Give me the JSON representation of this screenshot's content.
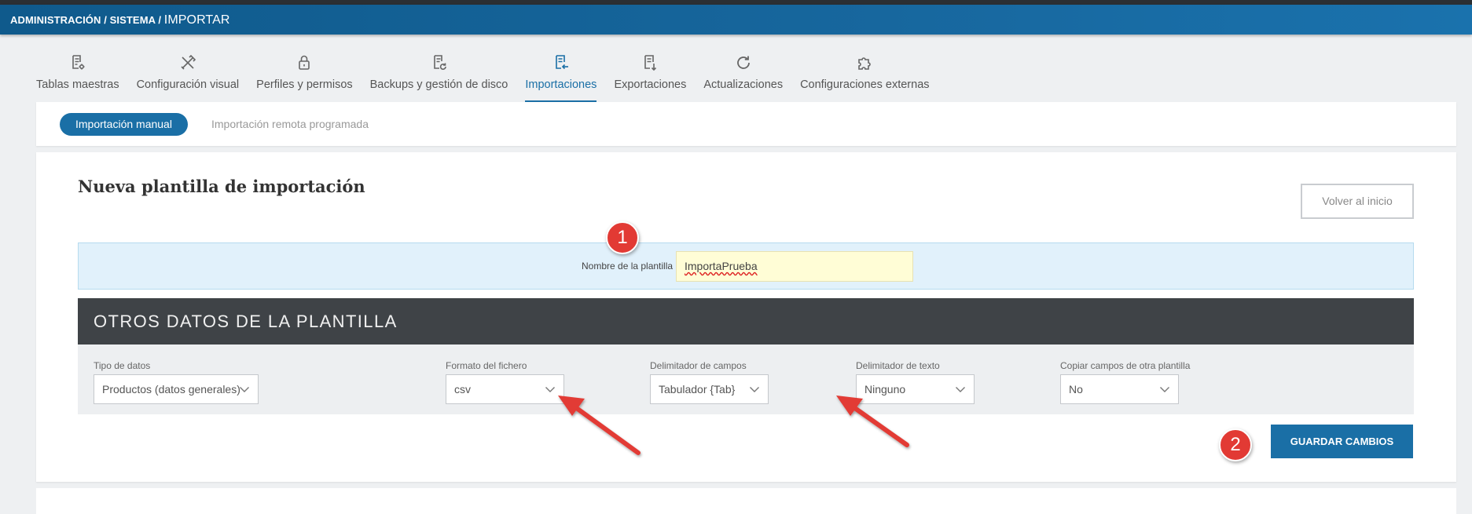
{
  "header": {
    "breadcrumb_prefix": "ADMINISTRACIÓN / SISTEMA / ",
    "breadcrumb_current": "IMPORTAR"
  },
  "tabs": [
    {
      "label": "Tablas maestras",
      "icon": "table-settings-icon"
    },
    {
      "label": "Configuración visual",
      "icon": "tools-icon"
    },
    {
      "label": "Perfiles y permisos",
      "icon": "lock-icon"
    },
    {
      "label": "Backups y gestión de disco",
      "icon": "backup-icon"
    },
    {
      "label": "Importaciones",
      "icon": "import-icon",
      "active": true
    },
    {
      "label": "Exportaciones",
      "icon": "export-icon"
    },
    {
      "label": "Actualizaciones",
      "icon": "refresh-icon"
    },
    {
      "label": "Configuraciones externas",
      "icon": "puzzle-icon"
    }
  ],
  "subtabs": {
    "active": "Importación manual",
    "other": "Importación remota programada"
  },
  "form": {
    "title": "Nueva plantilla de importación",
    "back_button": "Volver al inicio",
    "name_label": "Nombre de la plantilla",
    "name_value": "ImportaPrueba",
    "section_title": "OTROS DATOS DE LA PLANTILLA",
    "fields": [
      {
        "label": "Tipo de datos",
        "value": "Productos (datos generales)"
      },
      {
        "label": "Formato del fichero",
        "value": "csv"
      },
      {
        "label": "Delimitador de campos",
        "value": "Tabulador {Tab}"
      },
      {
        "label": "Delimitador de texto",
        "value": "Ninguno"
      },
      {
        "label": "Copiar campos de otra plantilla",
        "value": "No"
      }
    ],
    "save_button": "GUARDAR CAMBIOS"
  },
  "annotations": {
    "badge_1": "1",
    "badge_2": "2",
    "badge_color": "#e23a34"
  },
  "colors": {
    "accent": "#1a6fa6",
    "dark_header": "#3f4347",
    "name_input_bg": "#fffdd6"
  }
}
